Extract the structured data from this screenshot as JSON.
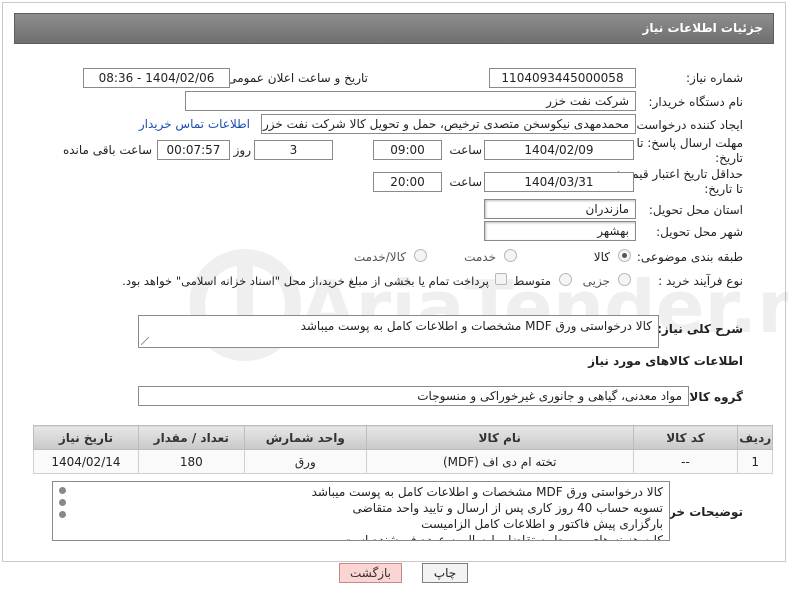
{
  "panel": {
    "title": "جزئیات اطلاعات نیاز"
  },
  "form": {
    "need_number": {
      "label": "شماره نیاز:",
      "value": "1104093445000058"
    },
    "announce": {
      "label": "تاریخ و ساعت اعلان عمومی:",
      "value": "1404/02/06 - 08:36"
    },
    "buyer_org": {
      "label": "نام دستگاه خریدار:",
      "value": "شرکت نفت خزر"
    },
    "requester": {
      "label": "ایجاد کننده درخواست:",
      "value": "محمدمهدی نیکوسخن متصدی ترخیص، حمل و تحویل کالا شرکت نفت خزر",
      "contact_link": "اطلاعات تماس خریدار"
    },
    "deadline": {
      "label_line1": "مهلت ارسال پاسخ: تا",
      "label_line2": "تاریخ:",
      "date": "1404/02/09",
      "time_label": "ساعت",
      "time": "09:00",
      "days": "3",
      "days_label": "روز و",
      "remaining": "00:07:57",
      "remaining_label": "ساعت باقی مانده"
    },
    "price_validity": {
      "label_line1": "حداقل تاریخ اعتبار قیمت:",
      "label_line2": "تا تاریخ:",
      "date": "1404/03/31",
      "time_label": "ساعت",
      "time": "20:00"
    },
    "province": {
      "label": "استان محل تحویل:",
      "value": "مازندران"
    },
    "city": {
      "label": "شهر محل تحویل:",
      "value": "بهشهر"
    },
    "category": {
      "label": "طبقه بندی موضوعی:",
      "options": [
        "کالا",
        "خدمت",
        "کالا/خدمت"
      ],
      "selected": "کالا"
    },
    "process": {
      "label": "نوع فرآیند خرید :",
      "options": [
        "جزیی",
        "متوسط"
      ],
      "selected": "",
      "payment_note": "پرداخت تمام یا بخشی از مبلغ خرید،از محل \"اسناد خزانه اسلامی\" خواهد بود."
    }
  },
  "need_description": {
    "label": "شرح کلی نیاز:",
    "value": "کالا درخواستی  ورق MDF   مشخصات و اطلاعات کامل به پوست میباشد"
  },
  "goods_section": {
    "title": "اطلاعات کالاهای مورد نیاز"
  },
  "goods_group": {
    "label": "گروه کالا:",
    "value": "مواد معدنی، گیاهی و جانوری غیرخوراکی و منسوجات"
  },
  "table": {
    "headers": [
      "ردیف",
      "کد کالا",
      "نام کالا",
      "واحد شمارش",
      "تعداد / مقدار",
      "تاریخ نیاز"
    ],
    "rows": [
      {
        "row": "1",
        "code": "--",
        "name": "تخته ام دی اف (MDF)",
        "unit": "ورق",
        "qty": "180",
        "date": "1404/02/14"
      }
    ]
  },
  "buyer_notes": {
    "label": "توضیحات خریدار:",
    "lines": [
      "کالا درخواستی  ورق MDF   مشخصات و اطلاعات کامل به پوست میباشد",
      "تسویه حساب 40 روز کاری پس از ارسال و تایید واحد متقاضی",
      "بارگزاری پیش فاکتور و اطلاعات کامل الزامیست",
      "کلیه هزینه های مربوط به تقاضا و ارسال  به عهده فروشنده است"
    ]
  },
  "buttons": {
    "print": "چاپ",
    "back": "بازگشت"
  },
  "watermark": {
    "text": "AriaTender.net"
  },
  "colors": {
    "header": "#7a7a7a",
    "link": "#1a4fb0",
    "back_button": "#fbd4d4"
  }
}
